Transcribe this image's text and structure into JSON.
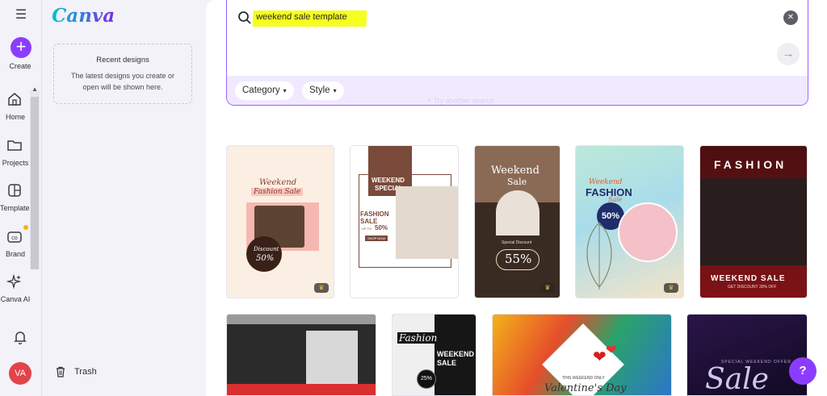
{
  "rail": {
    "items": [
      {
        "label": "Create",
        "icon": "plus-icon"
      },
      {
        "label": "Home",
        "icon": "home-icon"
      },
      {
        "label": "Projects",
        "icon": "folder-icon"
      },
      {
        "label": "Templates",
        "icon": "templates-icon"
      },
      {
        "label": "Brand",
        "icon": "brand-icon"
      },
      {
        "label": "Canva AI",
        "icon": "sparkle-icon"
      }
    ],
    "avatar_initials": "VA"
  },
  "panel": {
    "logo": "Canva",
    "recent_title": "Recent designs",
    "recent_desc": "The latest designs you create or open will be shown here.",
    "trash_label": "Trash"
  },
  "search": {
    "query": "weekend sale template",
    "filters": [
      "Category",
      "Style"
    ],
    "faint_hint": "+ Try another search"
  },
  "templates": [
    {
      "lines": [
        "Weekend",
        "Fashion Sale",
        "Discount",
        "50%"
      ],
      "premium": true
    },
    {
      "lines": [
        "WEEKEND",
        "SPECIAL",
        "FASHION",
        "SALE",
        "UP TO",
        "50%",
        "SHOP NOW"
      ],
      "premium": false
    },
    {
      "lines": [
        "Weekend",
        "Sale",
        "Special Discount",
        "55%"
      ],
      "premium": true
    },
    {
      "lines": [
        "Weekend",
        "FASHION",
        "Sale",
        "50%"
      ],
      "premium": true
    },
    {
      "lines": [
        "FASHION",
        "WEEKEND SALE",
        "GET DISCOUNT 30% OFF"
      ],
      "premium": false
    },
    {
      "lines": [],
      "premium": false
    },
    {
      "lines": [
        "Fashion",
        "WEEKEND",
        "SALE",
        "25%"
      ],
      "premium": false
    },
    {
      "lines": [
        "THIS WEEKEND ONLY",
        "Valentine's Day"
      ],
      "premium": false
    },
    {
      "lines": [
        "SPECIAL WEEKEND OFFER",
        "Sale"
      ],
      "premium": false
    }
  ],
  "help_label": "?",
  "colors": {
    "accent": "#8b3dff",
    "highlight": "#f6ff1f",
    "avatar": "#e2434b"
  }
}
